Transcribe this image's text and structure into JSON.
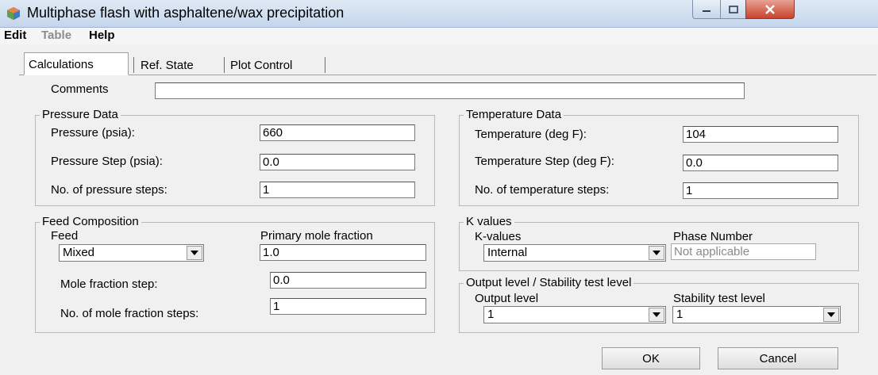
{
  "window": {
    "title": "Multiphase flash with asphaltene/wax precipitation"
  },
  "menu": {
    "items": [
      "Edit",
      "Table",
      "Help"
    ]
  },
  "tabs": [
    "Calculations",
    "Ref. State",
    "Plot Control"
  ],
  "comments": {
    "label": "Comments",
    "value": ""
  },
  "pressure": {
    "group_title": "Pressure Data",
    "pressure_label": "Pressure (psia):",
    "pressure_value": "660",
    "step_label": "Pressure Step (psia):",
    "step_value": "0.0",
    "nsteps_label": "No. of pressure steps:",
    "nsteps_value": "1"
  },
  "temperature": {
    "group_title": "Temperature Data",
    "temp_label": "Temperature (deg F):",
    "temp_value": "104",
    "step_label": "Temperature Step (deg F):",
    "step_value": "0.0",
    "nsteps_label": "No. of temperature steps:",
    "nsteps_value": "1"
  },
  "feed": {
    "group_title": "Feed Composition",
    "feed_label": "Feed",
    "feed_value": "Mixed",
    "primary_label": "Primary mole fraction",
    "primary_value": "1.0",
    "step_label": "Mole fraction step:",
    "step_value": "0.0",
    "nsteps_label": "No. of mole fraction steps:",
    "nsteps_value": "1"
  },
  "kvalues": {
    "group_title": "K values",
    "kvalues_label": "K-values",
    "kvalues_value": "Internal",
    "phase_label": "Phase Number",
    "phase_placeholder": "Not applicable"
  },
  "output": {
    "group_title": "Output level / Stability test level",
    "output_label": "Output level",
    "output_value": "1",
    "stability_label": "Stability test level",
    "stability_value": "1"
  },
  "buttons": {
    "ok": "OK",
    "cancel": "Cancel"
  }
}
